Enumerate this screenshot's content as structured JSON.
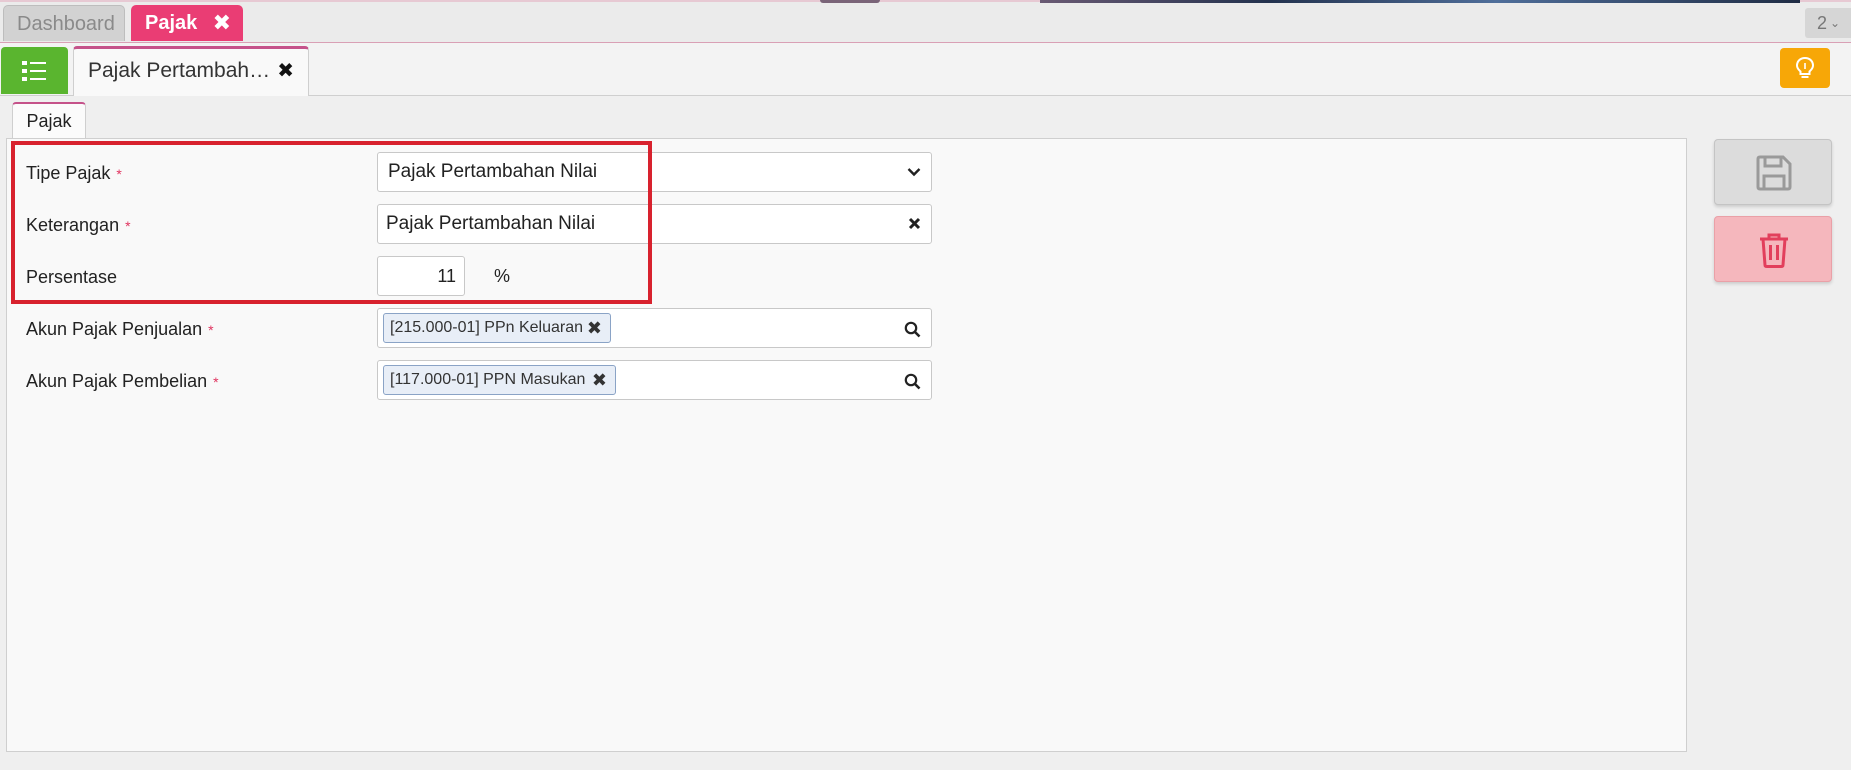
{
  "top_tabs": {
    "dashboard": "Dashboard",
    "pajak": "Pajak",
    "close_glyph": "✖",
    "counter": "2"
  },
  "sub_tab": {
    "title": "Pajak Pertambah…",
    "close_glyph": "✖"
  },
  "section_tab": "Pajak",
  "form": {
    "tipe_pajak": {
      "label": "Tipe Pajak",
      "value": "Pajak Pertambahan Nilai",
      "required_mark": "*"
    },
    "keterangan": {
      "label": "Keterangan",
      "value": "Pajak Pertambahan Nilai",
      "required_mark": "*"
    },
    "persentase": {
      "label": "Persentase",
      "value": "11",
      "unit": "%"
    },
    "akun_penjualan": {
      "label": "Akun Pajak Penjualan",
      "chip": "[215.000-01] PPn Keluaran",
      "required_mark": "*"
    },
    "akun_pembelian": {
      "label": "Akun Pajak Pembelian",
      "chip": "[117.000-01] PPN Masukan",
      "required_mark": "*"
    }
  },
  "colors": {
    "accent_pink": "#ea3d74",
    "list_green": "#5ab52f",
    "hint_orange": "#f7a707",
    "highlight_red": "#d8222e",
    "delete_pink": "#f5b7bd"
  },
  "icons": {
    "list": "list-icon",
    "bulb": "lightbulb-icon",
    "save": "floppy-disk-icon",
    "delete": "trash-icon",
    "search": "search-icon",
    "chevron": "chevron-down-icon",
    "clear": "clear-x-icon"
  }
}
